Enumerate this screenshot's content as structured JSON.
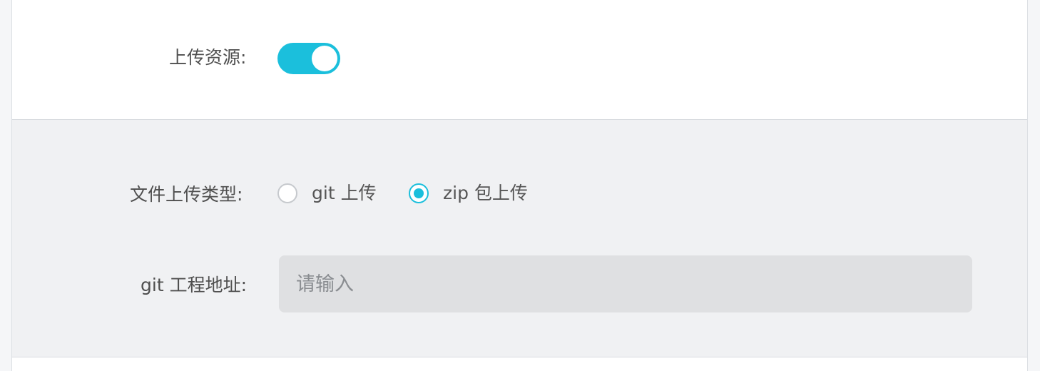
{
  "form": {
    "upload_resource": {
      "label": "上传资源:",
      "enabled": true,
      "accent_color": "#1bbfdc"
    },
    "file_upload_type": {
      "label": "文件上传类型:",
      "options": [
        {
          "label": "git 上传",
          "checked": false
        },
        {
          "label": "zip 包上传",
          "checked": true
        }
      ]
    },
    "git_project_url": {
      "label": "git 工程地址:",
      "placeholder": "请输入",
      "value": ""
    }
  }
}
